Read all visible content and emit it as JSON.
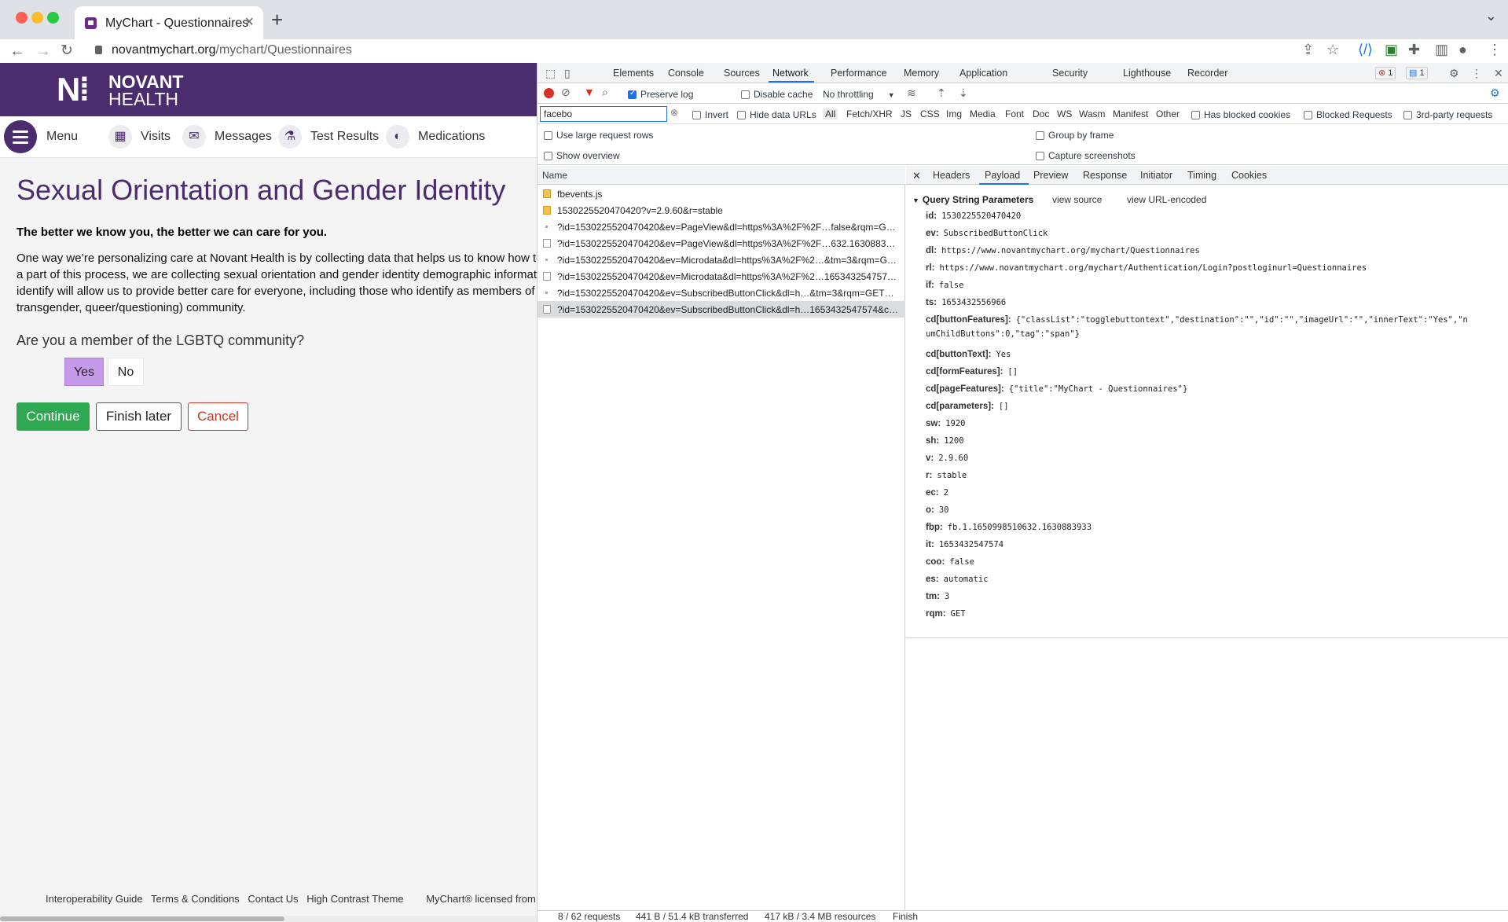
{
  "browser": {
    "tab_title": "MyChart - Questionnaires",
    "url_host": "novantmychart.org",
    "url_path": "/mychart/Questionnaires",
    "new_tab_glyph": "+",
    "close_glyph": "×"
  },
  "site": {
    "logo_line1": "NOVANT",
    "logo_line2": "HEALTH",
    "menu_label": "Menu",
    "nav": [
      {
        "label": "Visits",
        "icon": "calendar-icon"
      },
      {
        "label": "Messages",
        "icon": "envelope-icon"
      },
      {
        "label": "Test Results",
        "icon": "flask-icon"
      },
      {
        "label": "Medications",
        "icon": "pills-icon"
      }
    ],
    "title": "Sexual Orientation and Gender Identity",
    "subheading": "The better we know you, the better we can care for you.",
    "intro_lines": [
      "One way we’re personalizing care at Novant Health is by collecting data that helps us to know how to p",
      "a part of this process, we are collecting sexual orientation and gender identity demographic informatio",
      "identify will allow us to provide better care for everyone, including those who identify as members of th",
      "transgender, queer/questioning) community."
    ],
    "question": "Are you a member of the LGBTQ community?",
    "yes_label": "Yes",
    "no_label": "No",
    "selected_answer": "Yes",
    "continue_label": "Continue",
    "finish_later_label": "Finish later",
    "cancel_label": "Cancel",
    "footer": [
      "Interoperability Guide",
      "Terms & Conditions",
      "Contact Us",
      "High Contrast Theme",
      "MyChart® licensed from Ep"
    ],
    "colors": {
      "brand": "#4b2c6e",
      "selected": "#c59ae8",
      "continue": "#2fa852",
      "cancel": "#c0392b"
    }
  },
  "devtools": {
    "tabs": [
      "Elements",
      "Console",
      "Sources",
      "Network",
      "Performance",
      "Memory",
      "Application",
      "Security",
      "Lighthouse",
      "Recorder"
    ],
    "active_tab": "Network",
    "error_count": "1",
    "message_count": "1",
    "preserve_log": "Preserve log",
    "disable_cache": "Disable cache",
    "throttling": "No throttling",
    "filter_value": "facebo",
    "invert": "Invert",
    "hide_data_urls": "Hide data URLs",
    "type_filters": [
      "All",
      "Fetch/XHR",
      "JS",
      "CSS",
      "Img",
      "Media",
      "Font",
      "Doc",
      "WS",
      "Wasm",
      "Manifest",
      "Other"
    ],
    "has_blocked_cookies": "Has blocked cookies",
    "blocked_requests": "Blocked Requests",
    "third_party": "3rd-party requests",
    "large_rows": "Use large request rows",
    "group_by_frame": "Group by frame",
    "show_overview": "Show overview",
    "capture_screenshots": "Capture screenshots",
    "name_header": "Name",
    "requests": [
      {
        "name": "fbevents.js",
        "kind": "js"
      },
      {
        "name": "1530225520470420?v=2.9.60&r=stable",
        "kind": "js"
      },
      {
        "name": "?id=1530225520470420&ev=PageView&dl=https%3A%2F%2F…false&rqm=G…",
        "kind": "none"
      },
      {
        "name": "?id=1530225520470420&ev=PageView&dl=https%3A%2F%2F…632.1630883…",
        "kind": "doc"
      },
      {
        "name": "?id=1530225520470420&ev=Microdata&dl=https%3A%2F%2…&tm=3&rqm=G…",
        "kind": "none"
      },
      {
        "name": "?id=1530225520470420&ev=Microdata&dl=https%3A%2F%2…165343254757…",
        "kind": "doc"
      },
      {
        "name": "?id=1530225520470420&ev=SubscribedButtonClick&dl=h…&tm=3&rqm=GET…",
        "kind": "none"
      },
      {
        "name": "?id=1530225520470420&ev=SubscribedButtonClick&dl=h…1653432547574&c…",
        "kind": "doc"
      }
    ],
    "selected_request_index": 7,
    "detail_tabs": [
      "Headers",
      "Payload",
      "Preview",
      "Response",
      "Initiator",
      "Timing",
      "Cookies"
    ],
    "active_detail_tab": "Payload",
    "qsp_title": "Query String Parameters",
    "view_source": "view source",
    "view_url_encoded": "view URL-encoded",
    "params": [
      {
        "k": "id:",
        "v": "1530225520470420"
      },
      {
        "k": "ev:",
        "v": "SubscribedButtonClick"
      },
      {
        "k": "dl:",
        "v": "https://www.novantmychart.org/mychart/Questionnaires"
      },
      {
        "k": "rl:",
        "v": "https://www.novantmychart.org/mychart/Authentication/Login?postloginurl=Questionnaires"
      },
      {
        "k": "if:",
        "v": "false"
      },
      {
        "k": "ts:",
        "v": "1653432556966"
      },
      {
        "k": "cd[buttonFeatures]:",
        "v": "{\"classList\":\"togglebuttontext\",\"destination\":\"\",\"id\":\"\",\"imageUrl\":\"\",\"innerText\":\"Yes\",\"n",
        "v2": "umChildButtons\":0,\"tag\":\"span\"}"
      },
      {
        "k": "cd[buttonText]:",
        "v": "Yes"
      },
      {
        "k": "cd[formFeatures]:",
        "v": "[]"
      },
      {
        "k": "cd[pageFeatures]:",
        "v": "{\"title\":\"MyChart - Questionnaires\"}"
      },
      {
        "k": "cd[parameters]:",
        "v": "[]"
      },
      {
        "k": "sw:",
        "v": "1920"
      },
      {
        "k": "sh:",
        "v": "1200"
      },
      {
        "k": "v:",
        "v": "2.9.60"
      },
      {
        "k": "r:",
        "v": "stable"
      },
      {
        "k": "ec:",
        "v": "2"
      },
      {
        "k": "o:",
        "v": "30"
      },
      {
        "k": "fbp:",
        "v": "fb.1.1650998510632.1630883933"
      },
      {
        "k": "it:",
        "v": "1653432547574"
      },
      {
        "k": "coo:",
        "v": "false"
      },
      {
        "k": "es:",
        "v": "automatic"
      },
      {
        "k": "tm:",
        "v": "3"
      },
      {
        "k": "rqm:",
        "v": "GET"
      }
    ],
    "status": {
      "requests": "8 / 62 requests",
      "transferred": "441 B / 51.4 kB transferred",
      "resources": "417 kB / 3.4 MB resources",
      "finish": "Finish"
    }
  }
}
